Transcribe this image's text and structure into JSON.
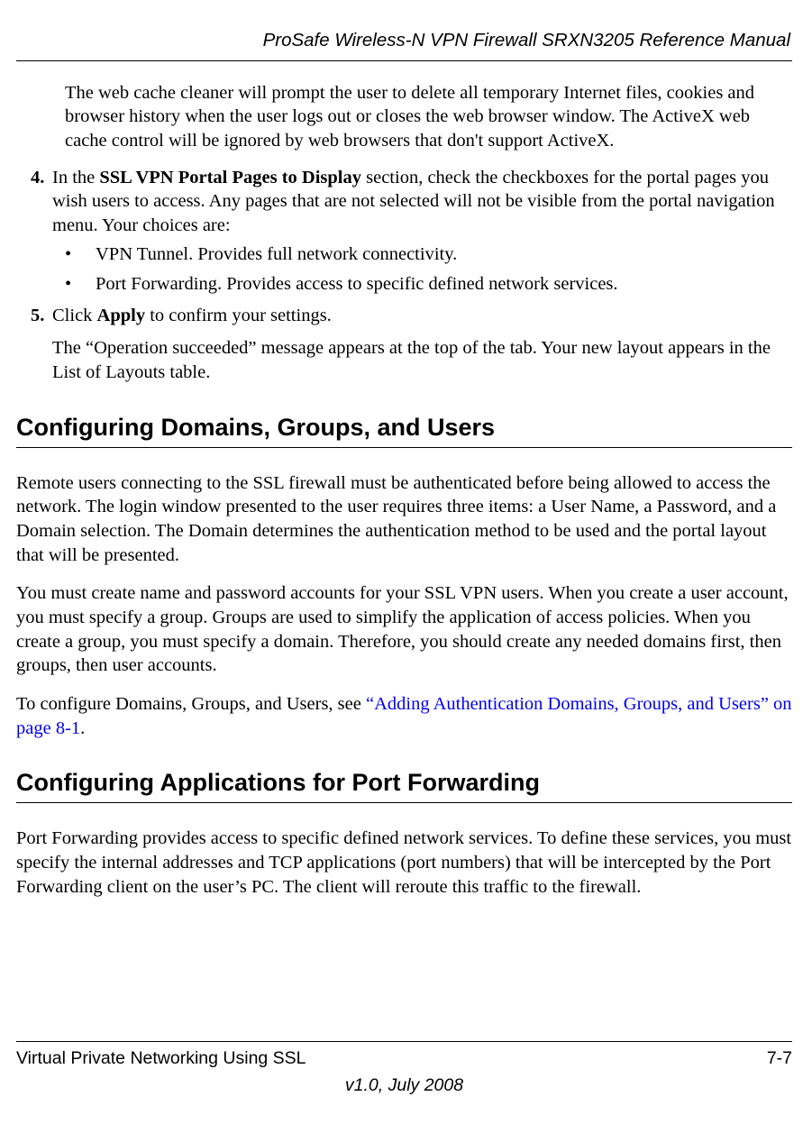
{
  "header": {
    "title": "ProSafe Wireless-N VPN Firewall SRXN3205 Reference Manual"
  },
  "body": {
    "intro_indent": "The web cache cleaner will prompt the user to delete all temporary Internet files, cookies and browser history when the user logs out or closes the web browser window. The ActiveX web cache control will be ignored by web browsers that don't support ActiveX.",
    "step4": {
      "num": "4.",
      "prefix": "In the ",
      "bold": "SSL VPN Portal Pages to Display",
      "suffix": " section, check the checkboxes for the portal pages you wish users to access. Any pages that are not selected will not be visible from the portal navigation menu. Your choices are:"
    },
    "bullets": [
      "VPN Tunnel. Provides full network connectivity.",
      "Port Forwarding. Provides access to specific defined network services."
    ],
    "step5": {
      "num": "5.",
      "prefix": "Click ",
      "bold": "Apply",
      "suffix": " to confirm your settings."
    },
    "step5_after": "The “Operation succeeded” message appears at the top of the tab. Your new layout appears in the List of Layouts table.",
    "heading1": "Configuring Domains, Groups, and Users",
    "h1_p1": "Remote users connecting to the SSL firewall must be authenticated before being allowed to access the network. The login window presented to the user requires three items: a User Name, a Password, and a Domain selection. The Domain determines the authentication method to be used and the portal layout that will be presented.",
    "h1_p2": "You must create name and password accounts for your SSL VPN users. When you create a user account, you must specify a group. Groups are used to simplify the application of access policies. When you create a group, you must specify a domain. Therefore, you should create any needed domains first, then groups, then user accounts.",
    "h1_p3_prefix": "To configure Domains, Groups, and Users, see ",
    "h1_p3_link": "“Adding Authentication Domains, Groups, and Users” on page 8-1",
    "h1_p3_suffix": ".",
    "heading2": "Configuring Applications for Port Forwarding",
    "h2_p1": "Port Forwarding provides access to specific defined network services. To define these services, you must specify the internal addresses and TCP applications (port numbers) that will be intercepted by the Port Forwarding client on the user’s PC. The client will reroute this traffic to the firewall."
  },
  "footer": {
    "left": "Virtual Private Networking Using SSL",
    "right": "7-7",
    "center": "v1.0, July 2008"
  },
  "bullet_char": "•"
}
